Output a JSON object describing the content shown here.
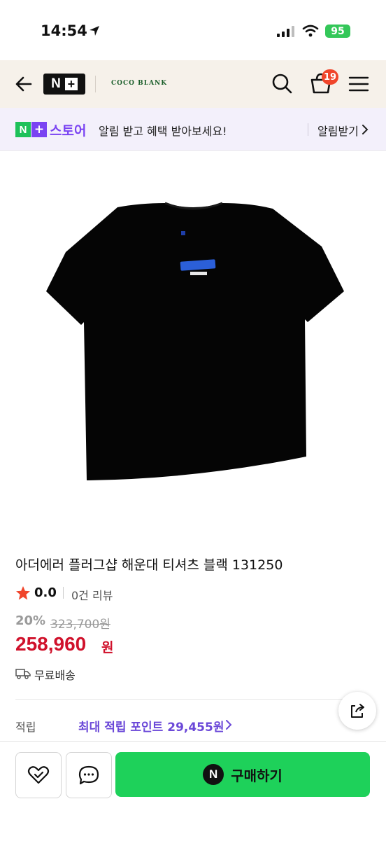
{
  "status_bar": {
    "time": "14:54",
    "battery": "95"
  },
  "header": {
    "logo_n": "N",
    "logo_plus": "+",
    "brand": "COCO BLANK",
    "cart_badge": "19"
  },
  "store_banner": {
    "logo_n": "N",
    "logo_plus": "+",
    "store_label": "스토어",
    "message": "알림 받고 혜택 받아보세요!",
    "action": "알림받기"
  },
  "product": {
    "title": "아더에러 플러그샵 해운대 티셔츠 블랙 131250",
    "rating": "0.0",
    "review_count": "0건 리뷰",
    "discount_rate": "20%",
    "original_price": "323,700원",
    "sale_price": "258,960",
    "sale_currency": "원",
    "shipping": "무료배송",
    "points_label": "적립",
    "points_text": "최대 적립 포인트 29,455원"
  },
  "bottom_bar": {
    "buy_n": "N",
    "buy_label": "구매하기"
  },
  "colors": {
    "header_bg": "#f6f1ea",
    "banner_bg": "#f3f0fb",
    "store_purple": "#7a43f2",
    "naver_green": "#1ed15a",
    "sale_red": "#d0112b",
    "points_purple": "#6b48d8"
  },
  "icons": [
    "back-arrow-icon",
    "search-icon",
    "shopping-bag-icon",
    "menu-icon",
    "chevron-right-icon",
    "star-icon",
    "truck-icon",
    "share-icon",
    "heart-icon",
    "chat-icon"
  ]
}
